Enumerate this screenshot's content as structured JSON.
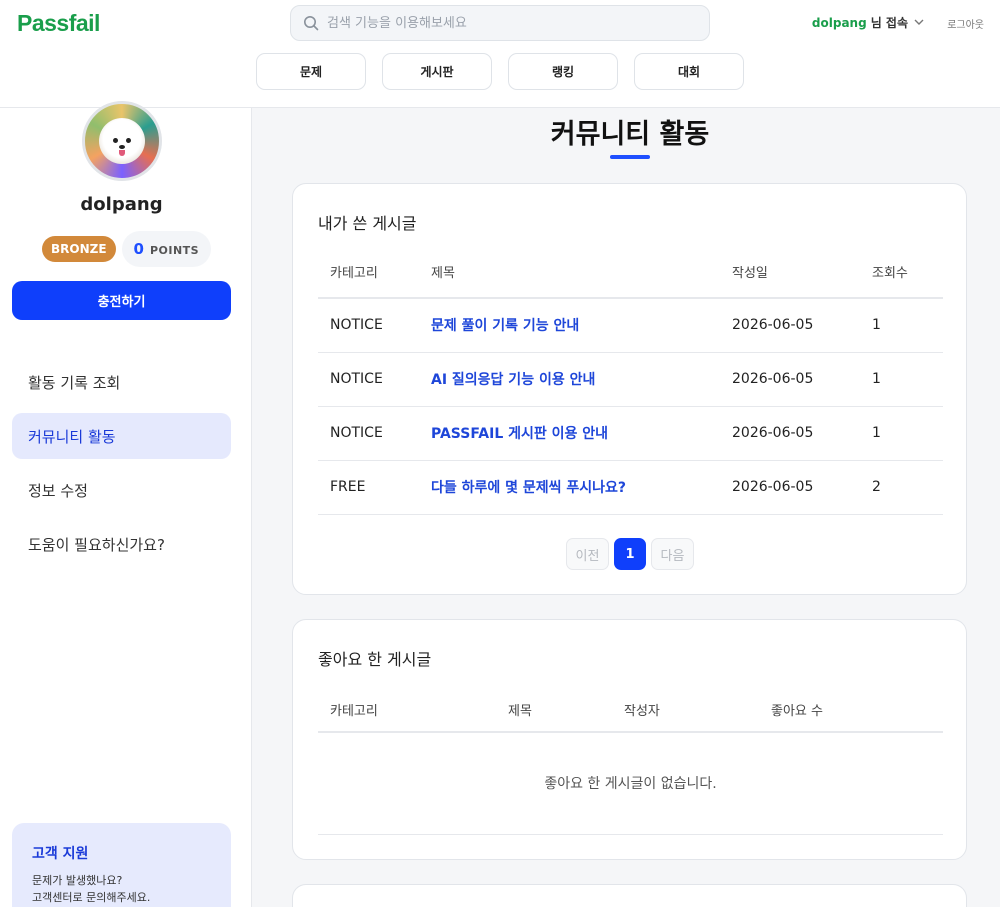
{
  "brand": {
    "logo": "Passfail",
    "logo_color": "#1a9e4b",
    "accent": "#0f3ffb"
  },
  "search": {
    "placeholder": "검색 기능을 이용해보세요",
    "icon": "search-icon"
  },
  "user": {
    "name": "dolpang",
    "suffix": "님 접속",
    "logout": "로그아웃"
  },
  "nav": [
    "문제",
    "게시판",
    "랭킹",
    "대회"
  ],
  "profile": {
    "name": "dolpang",
    "tier": "BRONZE",
    "points": "0",
    "points_label": "POINTS",
    "charge": "충전하기"
  },
  "sidebar": {
    "items": [
      {
        "label": "활동 기록 조회",
        "active": false
      },
      {
        "label": "커뮤니티 활동",
        "active": true
      },
      {
        "label": "정보 수정",
        "active": false
      },
      {
        "label": "도움이 필요하신가요?",
        "active": false
      }
    ],
    "support": {
      "title": "고객 지원",
      "line1": "문제가 발생했나요?",
      "line2": "고객센터로 문의해주세요."
    }
  },
  "main": {
    "title": "커뮤니티 활동",
    "my_posts": {
      "title": "내가 쓴 게시글",
      "columns": [
        "카테고리",
        "제목",
        "작성일",
        "조회수"
      ],
      "rows": [
        [
          "NOTICE",
          "문제 풀이 기록 기능 안내",
          "2026-06-05",
          "1"
        ],
        [
          "NOTICE",
          "AI 질의응답 기능 이용 안내",
          "2026-06-05",
          "1"
        ],
        [
          "NOTICE",
          "PASSFAIL 게시판 이용 안내",
          "2026-06-05",
          "1"
        ],
        [
          "FREE",
          "다들 하루에 몇 문제씩 푸시나요?",
          "2026-06-05",
          "2"
        ]
      ],
      "pager": {
        "prev": "이전",
        "current": "1",
        "next": "다음"
      }
    },
    "liked_posts": {
      "title": "좋아요 한 게시글",
      "columns": [
        "카테고리",
        "제목",
        "작성자",
        "좋아요 수"
      ],
      "empty": "좋아요 한 게시글이 없습니다."
    }
  }
}
